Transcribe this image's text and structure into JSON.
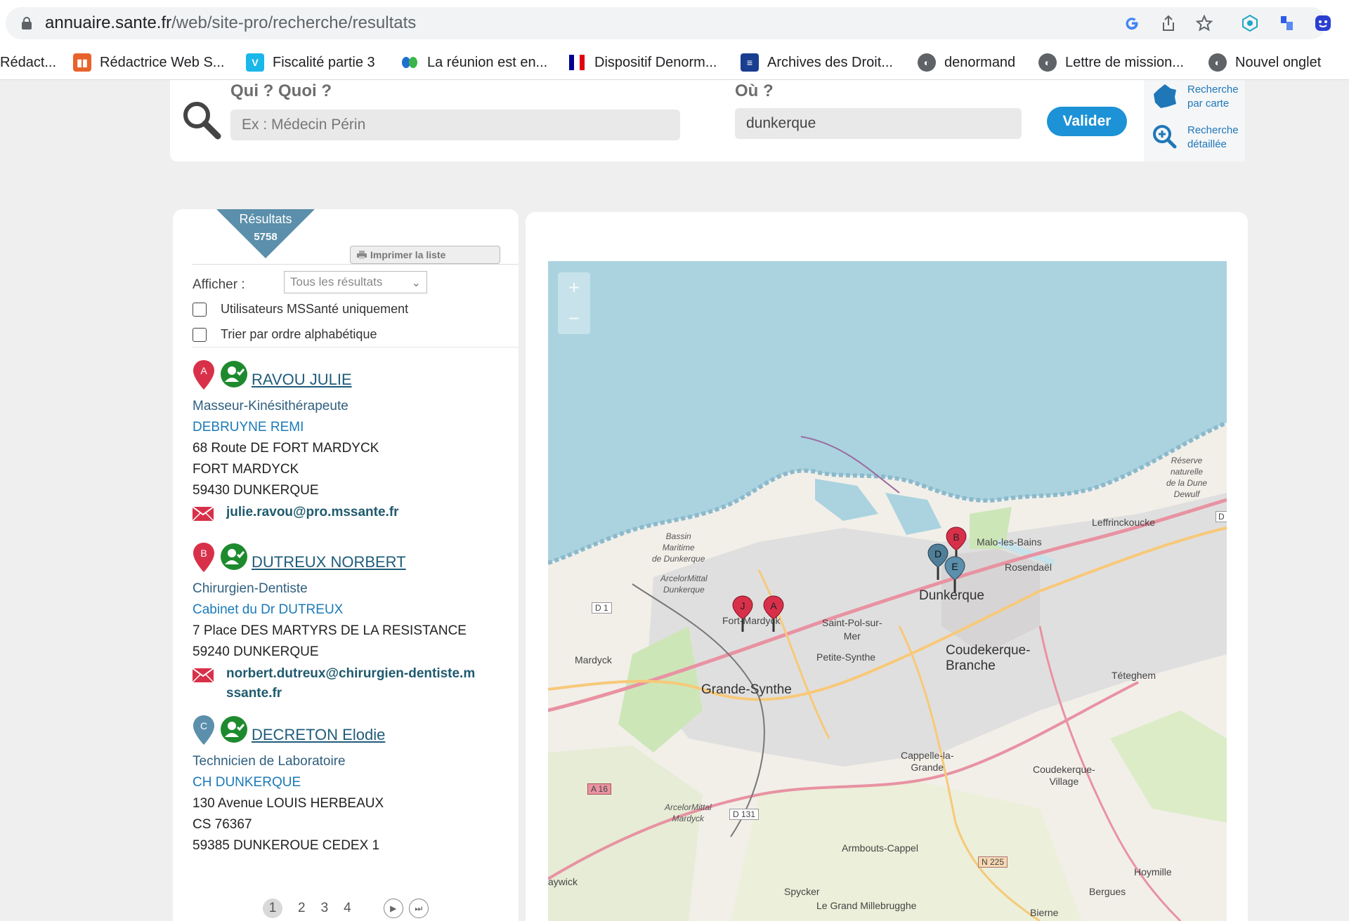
{
  "browser": {
    "url_host": "annuaire.sante.fr",
    "url_path": "/web/site-pro/recherche/resultats",
    "bookmarks": [
      {
        "label": "Rédact...",
        "icon": "none"
      },
      {
        "label": "Rédactrice Web S...",
        "icon": "orange-app-icon",
        "color": "#e8632b"
      },
      {
        "label": "Fiscalité partie 3",
        "icon": "vimeo-icon",
        "color": "#1ab7ea"
      },
      {
        "label": "La réunion est en...",
        "icon": "webex-icon",
        "color": "#1f6fd1"
      },
      {
        "label": "Dispositif Denorm...",
        "icon": "french-flag-icon",
        "color": "#000091"
      },
      {
        "label": "Archives des Droit...",
        "icon": "archive-icon",
        "color": "#1a3e8f"
      },
      {
        "label": "denormand",
        "icon": "globe-icon",
        "color": "#5f6368"
      },
      {
        "label": "Lettre de mission...",
        "icon": "globe-icon",
        "color": "#5f6368"
      },
      {
        "label": "Nouvel onglet",
        "icon": "globe-icon",
        "color": "#5f6368"
      }
    ]
  },
  "search": {
    "qui_label": "Qui ?  Quoi ?",
    "qui_placeholder": "Ex : Médecin Périn",
    "ou_label": "Où ?",
    "ou_value": "dunkerque",
    "submit_label": "Valider",
    "map_search_label": "Recherche par carte",
    "detailed_search_label": "Recherche détaillée"
  },
  "results": {
    "badge_title": "Résultats",
    "count": "5758",
    "print_label": "Imprimer la liste",
    "afficher_label": "Afficher :",
    "afficher_value": "Tous les résultats",
    "filter_mss": "Utilisateurs MSSanté uniquement",
    "filter_alpha": "Trier par ordre alphabétique",
    "items": [
      {
        "letter": "A",
        "pin_color": "#d9304a",
        "name": "RAVOU JULIE",
        "specialty": "Masseur-Kinésithérapeute",
        "organization": "DEBRUYNE REMI",
        "address": [
          "68 Route DE FORT MARDYCK",
          "FORT MARDYCK",
          "59430 DUNKERQUE"
        ],
        "email_lines": [
          "julie.ravou@pro.mssante.fr"
        ]
      },
      {
        "letter": "B",
        "pin_color": "#d9304a",
        "name": "DUTREUX NORBERT",
        "specialty": "Chirurgien-Dentiste",
        "organization": "Cabinet du Dr DUTREUX",
        "address": [
          "7 Place DES MARTYRS DE LA RESISTANCE",
          "59240 DUNKERQUE"
        ],
        "email_lines": [
          "norbert.dutreux@chirurgien-dentiste.m",
          "ssante.fr"
        ]
      },
      {
        "letter": "C",
        "pin_color": "#5b8fab",
        "name": "DECRETON Elodie",
        "specialty": "Technicien de Laboratoire",
        "organization": "CH DUNKERQUE",
        "address": [
          "130 Avenue LOUIS HERBEAUX",
          "CS 76367",
          "59385 DUNKERQUE CEDEX 1"
        ],
        "email_lines": []
      }
    ],
    "pages": [
      "1",
      "2",
      "3",
      "4"
    ]
  },
  "map": {
    "zoom_in": "+",
    "zoom_out": "−",
    "labels": {
      "dunkerque": "Dunkerque",
      "grande_synthe": "Grande-Synthe",
      "coudekerque_branche": "Coudekerque-\nBranche",
      "saint_pol": "Saint-Pol-sur-\nMer",
      "petite_synthe": "Petite-Synthe",
      "fort_mardyck": "Fort-Mardyck",
      "mardyck": "Mardyck",
      "leffrinckoucke": "Leffrinckoucke",
      "teteghem": "Téteghem",
      "cappelle": "Cappelle-la-\nGrande",
      "coudekerque_village": "Coudekerque-\nVillage",
      "armbouts": "Armbouts-Cappel",
      "spycker": "Spycker",
      "millebrugghe": "Le Grand Millebrugghe",
      "hoymille": "Hoymille",
      "bergues": "Bergues",
      "bierne": "Bierne",
      "zuydcoote_reserve": "Réserve\nnaturelle\nde la Dune\nDewulf",
      "bassin": "Bassin\nMaritime\nde Dunkerque",
      "arcelor1": "ArcelorMittal\nDunkerque",
      "arcelor2": "ArcelorMittal\nMardyck",
      "malo": "Malo-les-Bains",
      "rosendael": "Rosendaël",
      "craywick": "aywick",
      "road_d1": "D 1",
      "road_a16": "A 16",
      "road_d131": "D 131",
      "road_n225": "N 225",
      "road_d": "D"
    },
    "markers": [
      {
        "letter": "J",
        "color": "#d9304a"
      },
      {
        "letter": "A",
        "color": "#d9304a"
      },
      {
        "letter": "B",
        "color": "#d9304a"
      },
      {
        "letter": "D",
        "color": "#4f7f98"
      },
      {
        "letter": "E",
        "color": "#5b8fab"
      }
    ],
    "water_color": "#aad3df",
    "land_color": "#f2efe9"
  }
}
